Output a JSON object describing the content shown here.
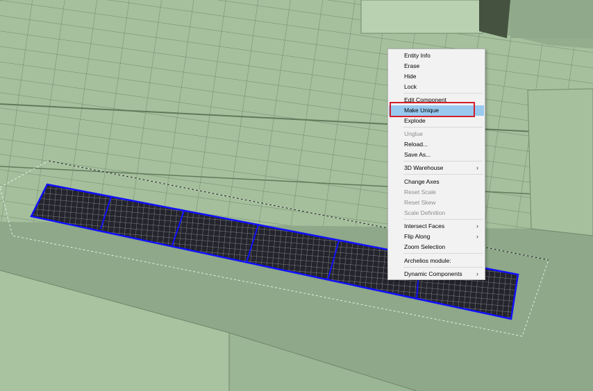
{
  "menu": {
    "items": [
      {
        "label": "Entity Info",
        "disabled": false
      },
      {
        "label": "Erase",
        "disabled": false
      },
      {
        "label": "Hide",
        "disabled": false
      },
      {
        "label": "Lock",
        "disabled": false
      },
      {
        "label": "Edit Component",
        "disabled": false
      },
      {
        "label": "Make Unique",
        "disabled": false,
        "highlighted": true
      },
      {
        "label": "Explode",
        "disabled": false
      },
      {
        "label": "Unglue",
        "disabled": true
      },
      {
        "label": "Reload...",
        "disabled": false
      },
      {
        "label": "Save As...",
        "disabled": false
      },
      {
        "label": "3D Warehouse",
        "disabled": false,
        "submenu": true
      },
      {
        "label": "Change Axes",
        "disabled": false
      },
      {
        "label": "Reset Scale",
        "disabled": true
      },
      {
        "label": "Reset Skew",
        "disabled": true
      },
      {
        "label": "Scale Definition",
        "disabled": true
      },
      {
        "label": "Intersect Faces",
        "disabled": false,
        "submenu": true
      },
      {
        "label": "Flip Along",
        "disabled": false,
        "submenu": true
      },
      {
        "label": "Zoom Selection",
        "disabled": false
      },
      {
        "label": "Archelios module:",
        "disabled": false
      },
      {
        "label": "Dynamic Components",
        "disabled": false,
        "submenu": true
      }
    ],
    "submenu_arrow": "›"
  },
  "colors": {
    "roof": "#a7c19f",
    "panel": "#26262e",
    "selection": "#1010ff",
    "menu_highlight": "#99c9ef",
    "callout": "#d0202c"
  },
  "icons": {
    "submenu": "chevron-right-icon"
  }
}
